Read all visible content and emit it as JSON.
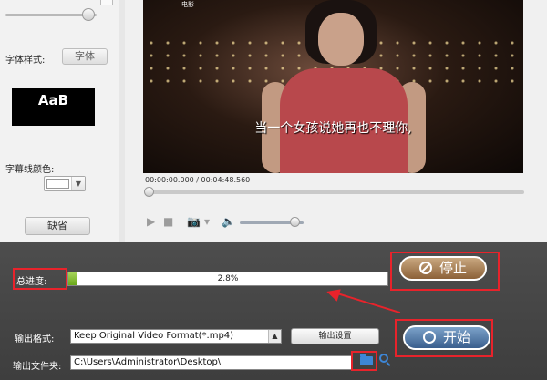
{
  "left_panel": {
    "font_style_label": "字体样式:",
    "font_button": "字体",
    "preview_text": "AaB",
    "subtitle_color_label": "字幕线颜色:",
    "default_button": "缺省"
  },
  "player": {
    "watermark": "电影",
    "subtitle": "当一个女孩说她再也不理你,",
    "timecode": "00:00:00.000 / 00:04:48.560",
    "seek_progress": 0,
    "volume_level": 0.85,
    "controls": {
      "play": "▶",
      "stop": "■",
      "camera": "📷",
      "camera_menu": "▾",
      "volume": "🔈"
    }
  },
  "progress": {
    "label": "总进度:",
    "percent_text": "2.8%",
    "value": 0.028
  },
  "buttons": {
    "stop": "停止",
    "start": "开始",
    "output_settings": "输出设置"
  },
  "output": {
    "format_label": "输出格式:",
    "format_value": "Keep Original Video Format(*.mp4)",
    "folder_label": "输出文件夹:",
    "folder_value": "C:\\Users\\Administrator\\Desktop\\"
  },
  "icons": {
    "folder": "folder-icon",
    "search": "search-icon",
    "dropdown": "▲",
    "color_dropdown": "▼"
  },
  "colors": {
    "annotation": "#e8232b",
    "progress_fill": "#7fb52a",
    "stop_button": "#a47a4c",
    "start_button": "#4e77a6",
    "folder_icon": "#3d86d6"
  }
}
